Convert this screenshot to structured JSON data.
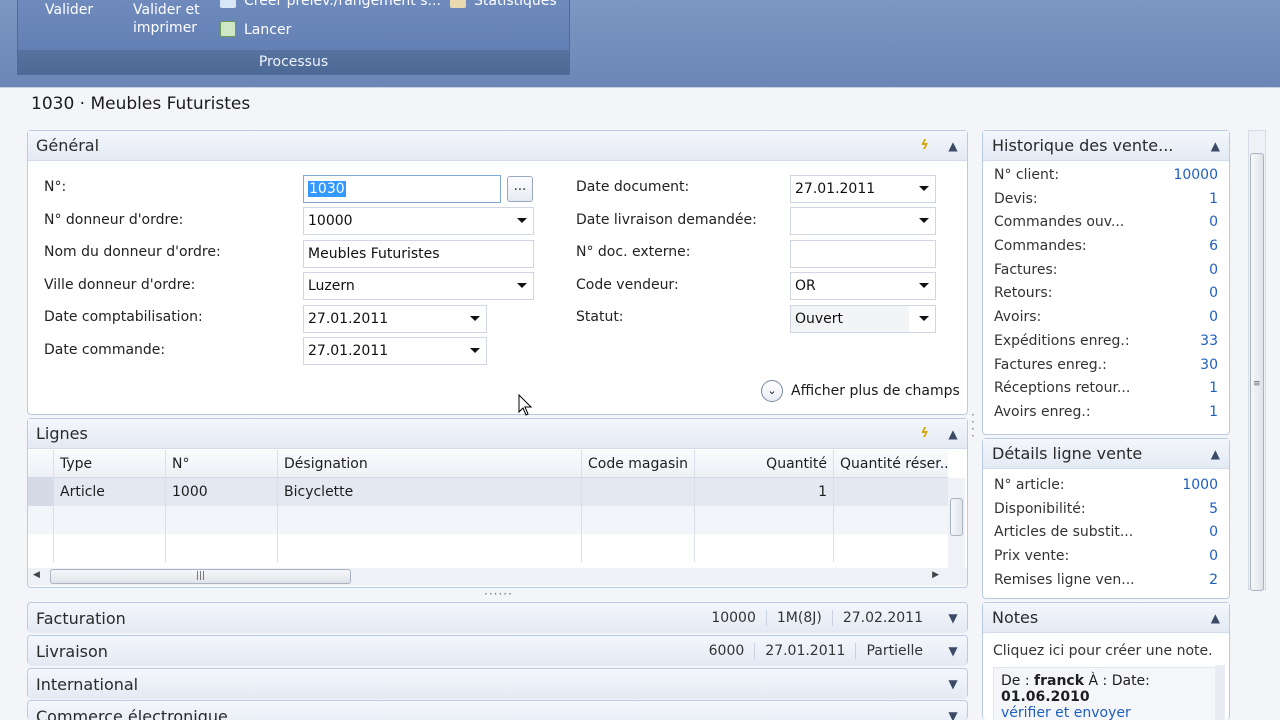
{
  "ribbon": {
    "valider": "Valider",
    "valider_imprimer": "Valider et\nimprimer",
    "creer": "Créer prélèv./rangement s...",
    "statistiques": "Statistiques",
    "lancer": "Lancer",
    "group_label": "Processus"
  },
  "page_title": "1030 · Meubles Futuristes",
  "general": {
    "title": "Général",
    "left_fields": [
      {
        "label": "N°:",
        "value": "1030"
      },
      {
        "label": "N° donneur d'ordre:",
        "value": "10000"
      },
      {
        "label": "Nom du donneur d'ordre:",
        "value": "Meubles Futuristes"
      },
      {
        "label": "Ville donneur d'ordre:",
        "value": "Luzern"
      },
      {
        "label": "Date comptabilisation:",
        "value": "27.01.2011"
      },
      {
        "label": "Date commande:",
        "value": "27.01.2011"
      }
    ],
    "right_fields": [
      {
        "label": "Date document:",
        "value": "27.01.2011"
      },
      {
        "label": "Date livraison demandée:",
        "value": ""
      },
      {
        "label": "N° doc. externe:",
        "value": ""
      },
      {
        "label": "Code vendeur:",
        "value": "OR"
      },
      {
        "label": "Statut:",
        "value": "Ouvert"
      }
    ],
    "ellipsis": "...",
    "more_fields": "Afficher plus de champs"
  },
  "lines": {
    "title": "Lignes",
    "columns": [
      "Type",
      "N°",
      "Désignation",
      "Code magasin",
      "Quantité",
      "Quantité réser..."
    ],
    "rows": [
      [
        "Article",
        "1000",
        "Bicyclette",
        "",
        "1",
        ""
      ]
    ]
  },
  "facturation": {
    "title": "Facturation",
    "summary": [
      "10000",
      "1M(8J)",
      "27.02.2011"
    ]
  },
  "livraison": {
    "title": "Livraison",
    "summary": [
      "6000",
      "27.01.2011",
      "Partielle"
    ]
  },
  "international": {
    "title": "International"
  },
  "commerce": {
    "title": "Commerce électronique"
  },
  "historique": {
    "title": "Historique des vente...",
    "rows": [
      {
        "label": "N° client:",
        "value": "10000"
      },
      {
        "label": "Devis:",
        "value": "1"
      },
      {
        "label": "Commandes ouv...",
        "value": "0"
      },
      {
        "label": "Commandes:",
        "value": "6"
      },
      {
        "label": "Factures:",
        "value": "0"
      },
      {
        "label": "Retours:",
        "value": "0"
      },
      {
        "label": "Avoirs:",
        "value": "0"
      },
      {
        "label": "Expéditions enreg.:",
        "value": "33"
      },
      {
        "label": "Factures enreg.:",
        "value": "30"
      },
      {
        "label": "Réceptions retour...",
        "value": "1"
      },
      {
        "label": "Avoirs enreg.:",
        "value": "1"
      }
    ]
  },
  "details": {
    "title": "Détails ligne vente",
    "rows": [
      {
        "label": "N° article:",
        "value": "1000"
      },
      {
        "label": "Disponibilité:",
        "value": "5"
      },
      {
        "label": "Articles de substit...",
        "value": "0"
      },
      {
        "label": "Prix vente:",
        "value": "0"
      },
      {
        "label": "Remises ligne ven...",
        "value": "2"
      }
    ]
  },
  "notes": {
    "title": "Notes",
    "create": "Cliquez ici pour créer une note.",
    "de_label": "De :",
    "de_value": "franck",
    "a_label": "À :",
    "date_label": "Date:",
    "date_value": "01.06.2010",
    "link": "vérifier et envoyer"
  }
}
